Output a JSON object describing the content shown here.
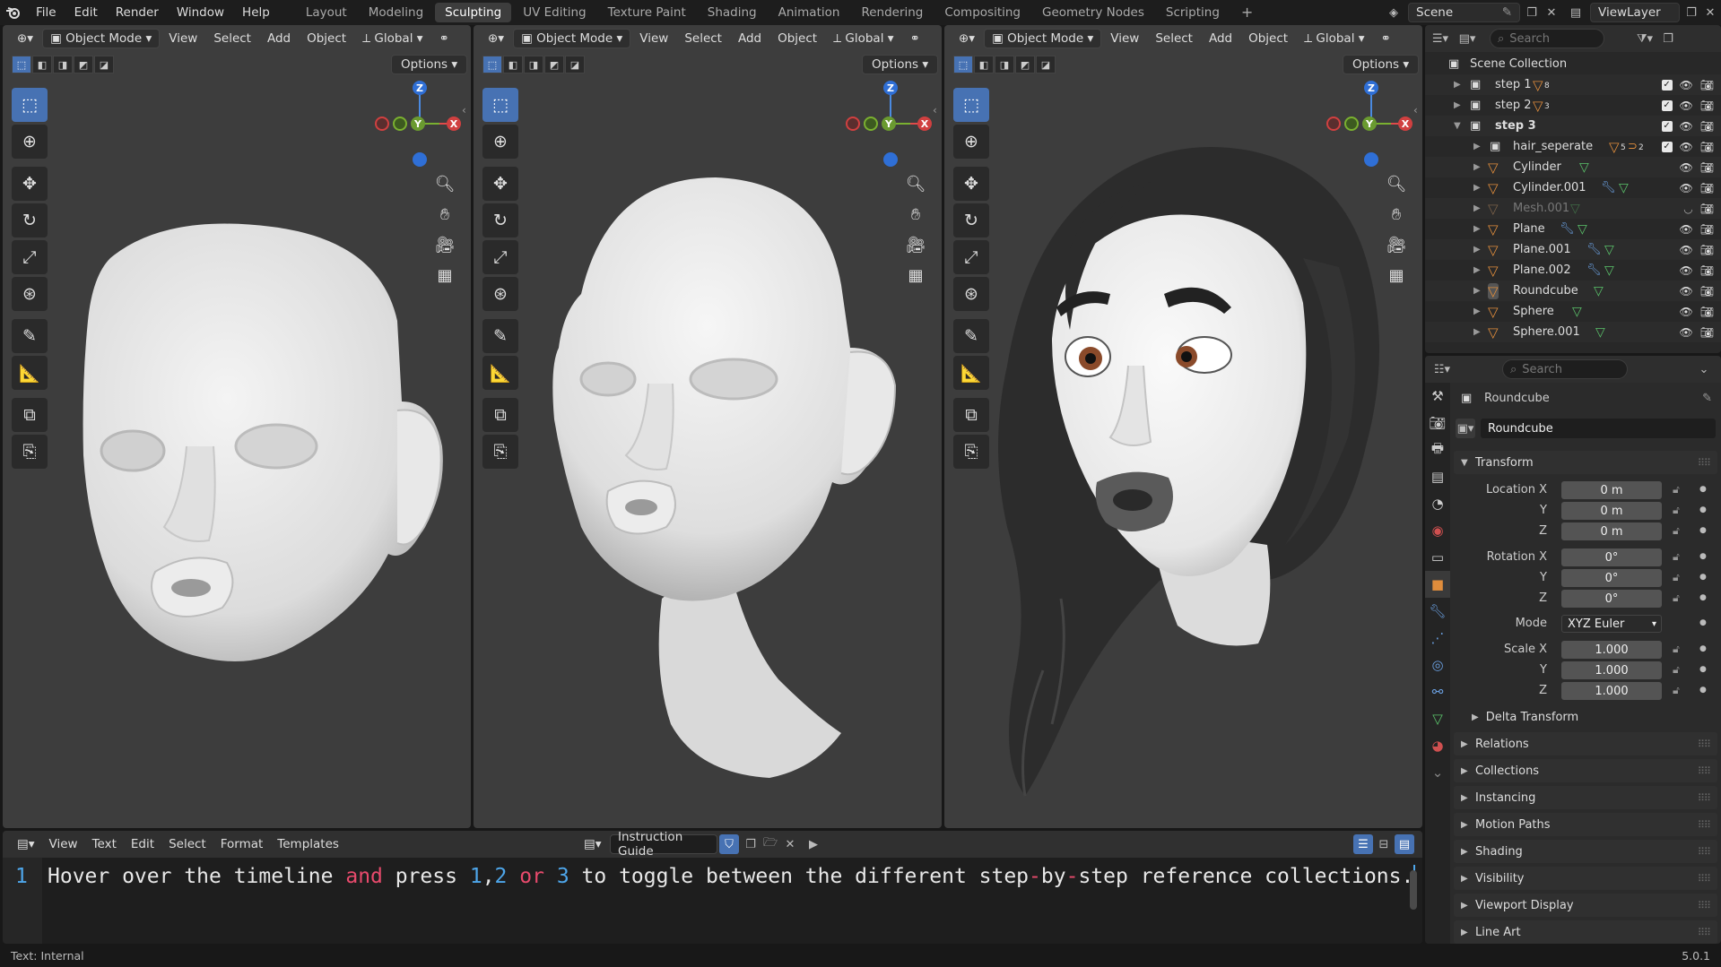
{
  "topbar": {
    "menus": [
      "File",
      "Edit",
      "Render",
      "Window",
      "Help"
    ],
    "workspaces": [
      "Layout",
      "Modeling",
      "Sculpting",
      "UV Editing",
      "Texture Paint",
      "Shading",
      "Animation",
      "Rendering",
      "Compositing",
      "Geometry Nodes",
      "Scripting"
    ],
    "active_workspace": "Sculpting",
    "add_tab": "+",
    "scene": "Scene",
    "view_layer": "ViewLayer"
  },
  "viewport": {
    "mode": "Object Mode",
    "menus": [
      "View",
      "Select",
      "Add",
      "Object"
    ],
    "orientation": "Global",
    "options": "Options",
    "gizmo_labels": {
      "z": "Z",
      "y": "Y",
      "x": "X"
    }
  },
  "text_editor": {
    "menus": [
      "View",
      "Text",
      "Edit",
      "Select",
      "Format",
      "Templates"
    ],
    "file_name": "Instruction Guide",
    "line_number": "1",
    "code": {
      "part1": "Hover over the timeline ",
      "and": "and",
      "part2": " press ",
      "n1": "1",
      "comma1": ",",
      "n2": "2",
      "or": "or",
      "n3": "3",
      "part3": " to toggle between the different step",
      "dash1": "-",
      "by": "by",
      "dash2": "-",
      "part4": "step reference collections."
    }
  },
  "status": {
    "left": "Text: Internal",
    "version": "5.0.1"
  },
  "outliner": {
    "search_placeholder": "Search",
    "root": "Scene Collection",
    "collections": [
      {
        "name": "step 1",
        "count": "8"
      },
      {
        "name": "step 2",
        "count": "3"
      },
      {
        "name": "step 3",
        "count": ""
      }
    ],
    "hair_collection": {
      "name": "hair_seperate",
      "count_a": "5",
      "count_b": "2"
    },
    "objects": [
      "Cylinder",
      "Cylinder.001",
      "Mesh.001",
      "Plane",
      "Plane.001",
      "Plane.002",
      "Roundcube",
      "Sphere",
      "Sphere.001"
    ]
  },
  "properties": {
    "search_placeholder": "Search",
    "object_name": "Roundcube",
    "datablock_name": "Roundcube",
    "transform": {
      "title": "Transform",
      "location_label": "Location X",
      "rotation_label": "Rotation X",
      "scale_label": "Scale X",
      "y_label": "Y",
      "z_label": "Z",
      "location": [
        "0 m",
        "0 m",
        "0 m"
      ],
      "rotation": [
        "0°",
        "0°",
        "0°"
      ],
      "mode_label": "Mode",
      "mode_value": "XYZ Euler",
      "scale": [
        "1.000",
        "1.000",
        "1.000"
      ],
      "delta": "Delta Transform"
    },
    "panels": [
      "Relations",
      "Collections",
      "Instancing",
      "Motion Paths",
      "Shading",
      "Visibility",
      "Viewport Display",
      "Line Art"
    ]
  },
  "colors": {
    "accent": "#4772b3",
    "mesh_orange": "#e08d3c",
    "data_green": "#5ac26a",
    "modifier_blue": "#6a9fe0"
  }
}
